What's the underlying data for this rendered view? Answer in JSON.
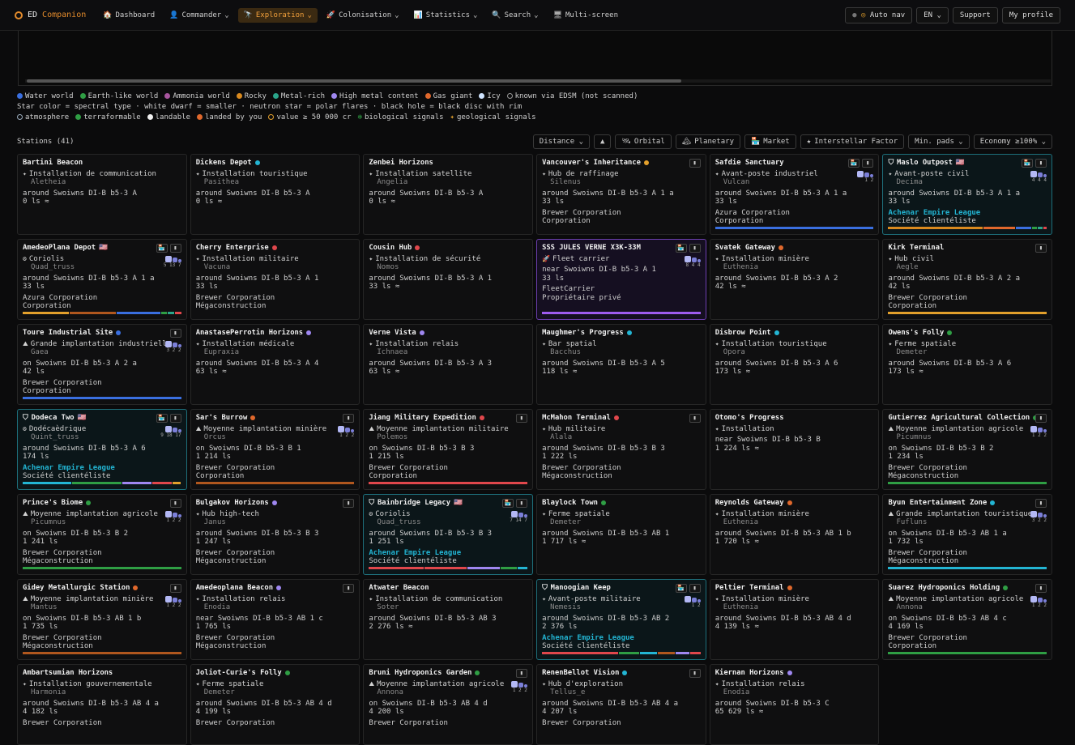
{
  "app": {
    "logo_a": "ED",
    "logo_b": "Companion"
  },
  "nav": [
    {
      "icon": "🏠",
      "label": "Dashboard",
      "active": false,
      "caret": ""
    },
    {
      "icon": "👤",
      "label": "Commander",
      "active": false,
      "caret": "⌄"
    },
    {
      "icon": "🔭",
      "label": "Exploration",
      "active": true,
      "caret": "⌄"
    },
    {
      "icon": "🚀",
      "label": "Colonisation",
      "active": false,
      "caret": "⌄"
    },
    {
      "icon": "📊",
      "label": "Statistics",
      "active": false,
      "caret": "⌄"
    },
    {
      "icon": "🔍",
      "label": "Search",
      "active": false,
      "caret": "⌄"
    },
    {
      "icon": "🖥",
      "label": "Multi-screen",
      "active": false,
      "caret": ""
    }
  ],
  "right": {
    "autonav": "Auto nav",
    "lang": "EN ⌄",
    "support": "Support",
    "profile": "My profile"
  },
  "legend": {
    "bodies": [
      {
        "label": "Water world",
        "color": "#3a6fe0"
      },
      {
        "label": "Earth-like world",
        "color": "#2f9e44"
      },
      {
        "label": "Ammonia world",
        "color": "#a8559e"
      },
      {
        "label": "Rocky",
        "color": "#d98a1f"
      },
      {
        "label": "Metal-rich",
        "color": "#2aa58a"
      },
      {
        "label": "High metal content",
        "color": "#9f87f0"
      },
      {
        "label": "Gas giant",
        "color": "#e0682c"
      },
      {
        "label": "Icy",
        "color": "#cfe4ff"
      },
      {
        "label": "known via EDSM (not scanned)",
        "color": "#0b0b0c"
      }
    ],
    "star_line": "Star color = spectral type · white dwarf = smaller · neutron star = polar flares · black hole = black disc with rim",
    "markers": [
      {
        "label": "atmosphere"
      },
      {
        "label": "terraformable"
      },
      {
        "label": "landable"
      },
      {
        "label": "landed by you"
      },
      {
        "label": "value ≥ 50 000 cr"
      },
      {
        "label": "biological signals"
      },
      {
        "label": "geological signals"
      }
    ]
  },
  "stations": {
    "title": "Stations (41)",
    "filters": [
      "Distance ⌄",
      "▲",
      "Orbital",
      "Planetary",
      "Market",
      "Interstellar Factor",
      "Min. pads ⌄",
      "Economy ≥100% ⌄"
    ]
  },
  "cards": [
    {
      "name": "Bartini Beacon",
      "dot": "",
      "flag": "",
      "type": "Installation de communication",
      "planet": "Aletheia",
      "around": "around Swoiwns DI-B b5-3 A",
      "dist": "0 ls ≈",
      "faction": "",
      "owner": "",
      "owner2": "",
      "kind": "",
      "btns": 0,
      "pads": ""
    },
    {
      "name": "Dickens Depot",
      "dot": "#23b5d3",
      "flag": "",
      "type": "Installation touristique",
      "planet": "Pasithea",
      "around": "around Swoiwns DI-B b5-3 A",
      "dist": "0 ls ≈",
      "faction": "",
      "owner": "",
      "owner2": "",
      "kind": "",
      "btns": 0,
      "pads": ""
    },
    {
      "name": "Zenbei Horizons",
      "dot": "",
      "flag": "",
      "type": "Installation satellite",
      "planet": "Angelia",
      "around": "around Swoiwns DI-B b5-3 A",
      "dist": "0 ls ≈",
      "faction": "",
      "owner": "",
      "owner2": "",
      "kind": "",
      "btns": 0,
      "pads": ""
    },
    {
      "name": "Vancouver's Inheritance",
      "dot": "#e3a02c",
      "flag": "",
      "type": "Hub de raffinage",
      "planet": "Silenus",
      "around": "around Swoiwns DI-B b5-3 A 1 a",
      "dist": "33 ls",
      "faction": "",
      "owner": "Brewer Corporation",
      "owner2": "Corporation",
      "kind": "",
      "btns": 1,
      "pads": ""
    },
    {
      "name": "Safdie Sanctuary",
      "dot": "",
      "flag": "",
      "type": "Avant-poste industriel",
      "planet": "Vulcan",
      "around": "around Swoiwns DI-B b5-3 A 1 a",
      "dist": "33 ls",
      "faction": "",
      "owner": "Azura Corporation",
      "owner2": "Corporation",
      "kind": "",
      "btns": 2,
      "pads": "1 2",
      "bar": [
        [
          "#3a6fe0",
          100
        ]
      ]
    },
    {
      "name": "Maslo Outpost",
      "dot": "",
      "flag": "🇺🇸",
      "type": "Avant-poste civil",
      "planet": "Decima",
      "around": "around Swoiwns DI-B b5-3 A 1 a",
      "dist": "33 ls",
      "faction": "Achenar Empire League",
      "owner": "Société clientéliste",
      "owner2": "",
      "kind": "hl",
      "btns": 2,
      "pads": "4 4 4",
      "bar": [
        [
          "#d98a1f",
          60
        ],
        [
          "#e0682c",
          20
        ],
        [
          "#3a6fe0",
          10
        ],
        [
          "#2f9e44",
          3
        ],
        [
          "#2aa58a",
          3
        ],
        [
          "#e0474c",
          2
        ]
      ]
    },
    {
      "name": "AmedeoPlana Depot",
      "dot": "",
      "flag": "🇺🇸",
      "type": "Coriolis",
      "planet": "Quad_truss",
      "around": "around Swoiwns DI-B b5-3 A 1 a",
      "dist": "33 ls",
      "faction": "",
      "owner": "Azura Corporation",
      "owner2": "Corporation",
      "kind": "",
      "btns": 2,
      "pads": "5 13 7",
      "bar": [
        [
          "#e3a02c",
          30
        ],
        [
          "#b0571e",
          30
        ],
        [
          "#3a6fe0",
          28
        ],
        [
          "#2f9e44",
          4
        ],
        [
          "#2aa58a",
          4
        ],
        [
          "#e0474c",
          4
        ]
      ]
    },
    {
      "name": "Cherry Enterprise",
      "dot": "#e0474c",
      "flag": "",
      "type": "Installation militaire",
      "planet": "Vacuna",
      "around": "around Swoiwns DI-B b5-3 A 1",
      "dist": "33 ls",
      "faction": "",
      "owner": "Brewer Corporation",
      "owner2": "Mégaconstruction",
      "kind": "",
      "btns": 0,
      "pads": ""
    },
    {
      "name": "Cousin Hub",
      "dot": "#e0474c",
      "flag": "",
      "type": "Installation de sécurité",
      "planet": "Nomos",
      "around": "around Swoiwns DI-B b5-3 A 1",
      "dist": "33 ls ≈",
      "faction": "",
      "owner": "",
      "owner2": "",
      "kind": "",
      "btns": 0,
      "pads": ""
    },
    {
      "name": "SSS JULES VERNE X3K-33M",
      "dot": "",
      "flag": "",
      "type": "Fleet carrier",
      "planet": "",
      "around": "near Swoiwns DI-B b5-3 A 1",
      "dist": "33 ls",
      "faction": "",
      "owner": "FleetCarrier",
      "owner2": "Propriétaire privé",
      "kind": "fc",
      "btns": 2,
      "pads": "8 4 4",
      "bar": [
        [
          "#9f5cf0",
          100
        ]
      ]
    },
    {
      "name": "Svatek Gateway",
      "dot": "#e0682c",
      "flag": "",
      "type": "Installation minière",
      "planet": "Euthenia",
      "around": "around Swoiwns DI-B b5-3 A 2",
      "dist": "42 ls ≈",
      "faction": "",
      "owner": "",
      "owner2": "",
      "kind": "",
      "btns": 0,
      "pads": ""
    },
    {
      "name": "Kirk Terminal",
      "dot": "",
      "flag": "",
      "type": "Hub civil",
      "planet": "Aegle",
      "around": "around Swoiwns DI-B b5-3 A 2 a",
      "dist": "42 ls",
      "faction": "",
      "owner": "Brewer Corporation",
      "owner2": "Corporation",
      "kind": "",
      "btns": 1,
      "pads": "",
      "bar": [
        [
          "#e3a02c",
          100
        ]
      ]
    },
    {
      "name": "Toure Industrial Site",
      "dot": "#3a6fe0",
      "flag": "",
      "type": "Grande implantation industrielle",
      "planet": "Gaea",
      "around": "on Swoiwns DI-B b5-3 A 2 a",
      "dist": "42 ls",
      "faction": "",
      "owner": "Brewer Corporation",
      "owner2": "Corporation",
      "kind": "",
      "btns": 1,
      "pads": "3 2 2",
      "bar": [
        [
          "#3a6fe0",
          100
        ]
      ]
    },
    {
      "name": "AnastasePerrotin Horizons",
      "dot": "#9f87f0",
      "flag": "",
      "type": "Installation médicale",
      "planet": "Eupraxia",
      "around": "around Swoiwns DI-B b5-3 A 4",
      "dist": "63 ls ≈",
      "faction": "",
      "owner": "",
      "owner2": "",
      "kind": "",
      "btns": 0,
      "pads": ""
    },
    {
      "name": "Verne Vista",
      "dot": "#9f87f0",
      "flag": "",
      "type": "Installation relais",
      "planet": "Ichnaea",
      "around": "around Swoiwns DI-B b5-3 A 3",
      "dist": "63 ls ≈",
      "faction": "",
      "owner": "",
      "owner2": "",
      "kind": "",
      "btns": 0,
      "pads": ""
    },
    {
      "name": "Maughmer's Progress",
      "dot": "#23b5d3",
      "flag": "",
      "type": "Bar spatial",
      "planet": "Bacchus",
      "around": "around Swoiwns DI-B b5-3 A 5",
      "dist": "118 ls ≈",
      "faction": "",
      "owner": "",
      "owner2": "",
      "kind": "",
      "btns": 0,
      "pads": ""
    },
    {
      "name": "Disbrow Point",
      "dot": "#23b5d3",
      "flag": "",
      "type": "Installation touristique",
      "planet": "Opora",
      "around": "around Swoiwns DI-B b5-3 A 6",
      "dist": "173 ls ≈",
      "faction": "",
      "owner": "",
      "owner2": "",
      "kind": "",
      "btns": 0,
      "pads": ""
    },
    {
      "name": "Owens's Folly",
      "dot": "#2f9e44",
      "flag": "",
      "type": "Ferme spatiale",
      "planet": "Demeter",
      "around": "around Swoiwns DI-B b5-3 A 6",
      "dist": "173 ls ≈",
      "faction": "",
      "owner": "",
      "owner2": "",
      "kind": "",
      "btns": 0,
      "pads": ""
    },
    {
      "name": "Dodeca Two",
      "dot": "",
      "flag": "🇺🇸",
      "type": "Dodécaèdrique",
      "planet": "Quint_truss",
      "around": "around Swoiwns DI-B b5-3 A 6",
      "dist": "174 ls",
      "faction": "Achenar Empire League",
      "owner": "Société clientéliste",
      "owner2": "",
      "kind": "hl",
      "btns": 2,
      "pads": "9 18 17",
      "bar": [
        [
          "#23b5d3",
          30
        ],
        [
          "#2f9e44",
          30
        ],
        [
          "#9f87f0",
          18
        ],
        [
          "#e0474c",
          12
        ],
        [
          "#e3a02c",
          5
        ]
      ]
    },
    {
      "name": "Sar's Burrow",
      "dot": "#e0682c",
      "flag": "",
      "type": "Moyenne implantation minière",
      "planet": "Orcus",
      "around": "on Swoiwns DI-B b5-3 B 1",
      "dist": "1 214 ls",
      "faction": "",
      "owner": "Brewer Corporation",
      "owner2": "Corporation",
      "kind": "",
      "btns": 1,
      "pads": "1 2 2",
      "bar": [
        [
          "#b0571e",
          100
        ]
      ]
    },
    {
      "name": "Jiang Military Expedition",
      "dot": "#e0474c",
      "flag": "",
      "type": "Moyenne implantation militaire",
      "planet": "Polemos",
      "around": "on Swoiwns DI-B b5-3 B 3",
      "dist": "1 215 ls",
      "faction": "",
      "owner": "Brewer Corporation",
      "owner2": "Corporation",
      "kind": "",
      "btns": 1,
      "pads": "",
      "bar": [
        [
          "#e0474c",
          100
        ]
      ]
    },
    {
      "name": "McMahon Terminal",
      "dot": "#e0474c",
      "flag": "",
      "type": "Hub militaire",
      "planet": "Alala",
      "around": "around Swoiwns DI-B b5-3 B 3",
      "dist": "1 222 ls",
      "faction": "",
      "owner": "Brewer Corporation",
      "owner2": "Mégaconstruction",
      "kind": "",
      "btns": 1,
      "pads": ""
    },
    {
      "name": "Otomo's Progress",
      "dot": "",
      "flag": "",
      "type": "Installation",
      "planet": "",
      "around": "near Swoiwns DI-B b5-3 B",
      "dist": "1 224 ls ≈",
      "faction": "",
      "owner": "",
      "owner2": "",
      "kind": "",
      "btns": 0,
      "pads": ""
    },
    {
      "name": "Gutierrez Agricultural Collection",
      "dot": "#2f9e44",
      "flag": "",
      "type": "Moyenne implantation agricole",
      "planet": "Picumnus",
      "around": "on Swoiwns DI-B b5-3 B 2",
      "dist": "1 234 ls",
      "faction": "",
      "owner": "Brewer Corporation",
      "owner2": "Mégaconstruction",
      "kind": "",
      "btns": 1,
      "pads": "1 2 2",
      "bar": [
        [
          "#2f9e44",
          100
        ]
      ]
    },
    {
      "name": "Prince's Biome",
      "dot": "#2f9e44",
      "flag": "",
      "type": "Moyenne implantation agricole",
      "planet": "Picumnus",
      "around": "on Swoiwns DI-B b5-3 B 2",
      "dist": "1 241 ls",
      "faction": "",
      "owner": "Brewer Corporation",
      "owner2": "Mégaconstruction",
      "kind": "",
      "btns": 1,
      "pads": "1 2 2",
      "bar": [
        [
          "#2f9e44",
          100
        ]
      ]
    },
    {
      "name": "Bulgakov Horizons",
      "dot": "#9f87f0",
      "flag": "",
      "type": "Hub high-tech",
      "planet": "Janus",
      "around": "around Swoiwns DI-B b5-3 B 3",
      "dist": "1 247 ls",
      "faction": "",
      "owner": "Brewer Corporation",
      "owner2": "Mégaconstruction",
      "kind": "",
      "btns": 1,
      "pads": ""
    },
    {
      "name": "Bainbridge Legacy",
      "dot": "",
      "flag": "🇺🇸",
      "type": "Coriolis",
      "planet": "Quad_truss",
      "around": "around Swoiwns DI-B b5-3 B 3",
      "dist": "1 251 ls",
      "faction": "Achenar Empire League",
      "owner": "Société clientéliste",
      "owner2": "",
      "kind": "hl",
      "btns": 2,
      "pads": "7 14 7",
      "bar": [
        [
          "#e0474c",
          34
        ],
        [
          "#e0474c",
          26
        ],
        [
          "#9f87f0",
          20
        ],
        [
          "#2f9e44",
          10
        ],
        [
          "#23b5d3",
          6
        ]
      ]
    },
    {
      "name": "Blaylock Town",
      "dot": "#2f9e44",
      "flag": "",
      "type": "Ferme spatiale",
      "planet": "Demeter",
      "around": "around Swoiwns DI-B b5-3 AB 1",
      "dist": "1 717 ls ≈",
      "faction": "",
      "owner": "",
      "owner2": "",
      "kind": "",
      "btns": 0,
      "pads": ""
    },
    {
      "name": "Reynolds Gateway",
      "dot": "#e0682c",
      "flag": "",
      "type": "Installation minière",
      "planet": "Euthenia",
      "around": "around Swoiwns DI-B b5-3 AB 1 b",
      "dist": "1 720 ls ≈",
      "faction": "",
      "owner": "",
      "owner2": "",
      "kind": "",
      "btns": 0,
      "pads": ""
    },
    {
      "name": "Byun Entertainment Zone",
      "dot": "#23b5d3",
      "flag": "",
      "type": "Grande implantation touristique",
      "planet": "Fufluns",
      "around": "on Swoiwns DI-B b5-3 AB 1 a",
      "dist": "1 732 ls",
      "faction": "",
      "owner": "Brewer Corporation",
      "owner2": "Mégaconstruction",
      "kind": "",
      "btns": 1,
      "pads": "3 2 2",
      "bar": [
        [
          "#23b5d3",
          100
        ]
      ]
    },
    {
      "name": "Gidey Metallurgic Station",
      "dot": "#e0682c",
      "flag": "",
      "type": "Moyenne implantation minière",
      "planet": "Mantus",
      "around": "on Swoiwns DI-B b5-3 AB 1 b",
      "dist": "1 735 ls",
      "faction": "",
      "owner": "Brewer Corporation",
      "owner2": "Mégaconstruction",
      "kind": "",
      "btns": 1,
      "pads": "1 2 2",
      "bar": [
        [
          "#b0571e",
          100
        ]
      ]
    },
    {
      "name": "Amedeoplana Beacon",
      "dot": "#9f87f0",
      "flag": "",
      "type": "Installation relais",
      "planet": "Enodia",
      "around": "near Swoiwns DI-B b5-3 AB 1 c",
      "dist": "1 765 ls",
      "faction": "",
      "owner": "Brewer Corporation",
      "owner2": "Mégaconstruction",
      "kind": "",
      "btns": 1,
      "pads": ""
    },
    {
      "name": "Atwater Beacon",
      "dot": "",
      "flag": "",
      "type": "Installation de communication",
      "planet": "Soter",
      "around": "around Swoiwns DI-B b5-3 AB 3",
      "dist": "2 276 ls ≈",
      "faction": "",
      "owner": "",
      "owner2": "",
      "kind": "",
      "btns": 0,
      "pads": ""
    },
    {
      "name": "Manoogian Keep",
      "dot": "",
      "flag": "",
      "type": "Avant-poste militaire",
      "planet": "Nemesis",
      "around": "around Swoiwns DI-B b5-3 AB 2",
      "dist": "2 376 ls",
      "faction": "Achenar Empire League",
      "owner": "Société clientéliste",
      "owner2": "",
      "kind": "hl",
      "btns": 2,
      "pads": "1 2",
      "bar": [
        [
          "#e0474c",
          45
        ],
        [
          "#2f9e44",
          12
        ],
        [
          "#23b5d3",
          10
        ],
        [
          "#b0571e",
          10
        ],
        [
          "#9f87f0",
          8
        ],
        [
          "#e0474c",
          6
        ]
      ]
    },
    {
      "name": "Peltier Terminal",
      "dot": "#e0682c",
      "flag": "",
      "type": "Installation minière",
      "planet": "Euthenia",
      "around": "around Swoiwns DI-B b5-3 AB 4 d",
      "dist": "4 139 ls ≈",
      "faction": "",
      "owner": "",
      "owner2": "",
      "kind": "",
      "btns": 0,
      "pads": ""
    },
    {
      "name": "Suarez Hydroponics Holding",
      "dot": "#2f9e44",
      "flag": "",
      "type": "Moyenne implantation agricole",
      "planet": "Annona",
      "around": "on Swoiwns DI-B b5-3 AB 4 c",
      "dist": "4 169 ls",
      "faction": "",
      "owner": "Brewer Corporation",
      "owner2": "Corporation",
      "kind": "",
      "btns": 1,
      "pads": "1 2 2",
      "bar": [
        [
          "#2f9e44",
          100
        ]
      ]
    },
    {
      "name": "Ambartsumian Horizons",
      "dot": "",
      "flag": "",
      "type": "Installation gouvernementale",
      "planet": "Harmonia",
      "around": "around Swoiwns DI-B b5-3 AB 4 a",
      "dist": "4 182 ls",
      "faction": "",
      "owner": "Brewer Corporation",
      "owner2": "",
      "kind": "",
      "btns": 0,
      "pads": ""
    },
    {
      "name": "Joliot-Curie's Folly",
      "dot": "#2f9e44",
      "flag": "",
      "type": "Ferme spatiale",
      "planet": "Demeter",
      "around": "around Swoiwns DI-B b5-3 AB 4 d",
      "dist": "4 199 ls",
      "faction": "",
      "owner": "Brewer Corporation",
      "owner2": "",
      "kind": "",
      "btns": 0,
      "pads": ""
    },
    {
      "name": "Bruni Hydroponics Garden",
      "dot": "#2f9e44",
      "flag": "",
      "type": "Moyenne implantation agricole",
      "planet": "Annona",
      "around": "on Swoiwns DI-B b5-3 AB 4 d",
      "dist": "4 200 ls",
      "faction": "",
      "owner": "Brewer Corporation",
      "owner2": "",
      "kind": "",
      "btns": 1,
      "pads": "1 2 2"
    },
    {
      "name": "RenenBellot Vision",
      "dot": "#23b5d3",
      "flag": "",
      "type": "Hub d'exploration",
      "planet": "Tellus_e",
      "around": "around Swoiwns DI-B b5-3 AB 4 a",
      "dist": "4 207 ls",
      "faction": "",
      "owner": "Brewer Corporation",
      "owner2": "",
      "kind": "",
      "btns": 1,
      "pads": ""
    },
    {
      "name": "Kiernan Horizons",
      "dot": "#9f87f0",
      "flag": "",
      "type": "Installation relais",
      "planet": "Enodia",
      "around": "around Swoiwns DI-B b5-3 C",
      "dist": "65 629 ls ≈",
      "faction": "",
      "owner": "",
      "owner2": "",
      "kind": "",
      "btns": 0,
      "pads": ""
    }
  ]
}
